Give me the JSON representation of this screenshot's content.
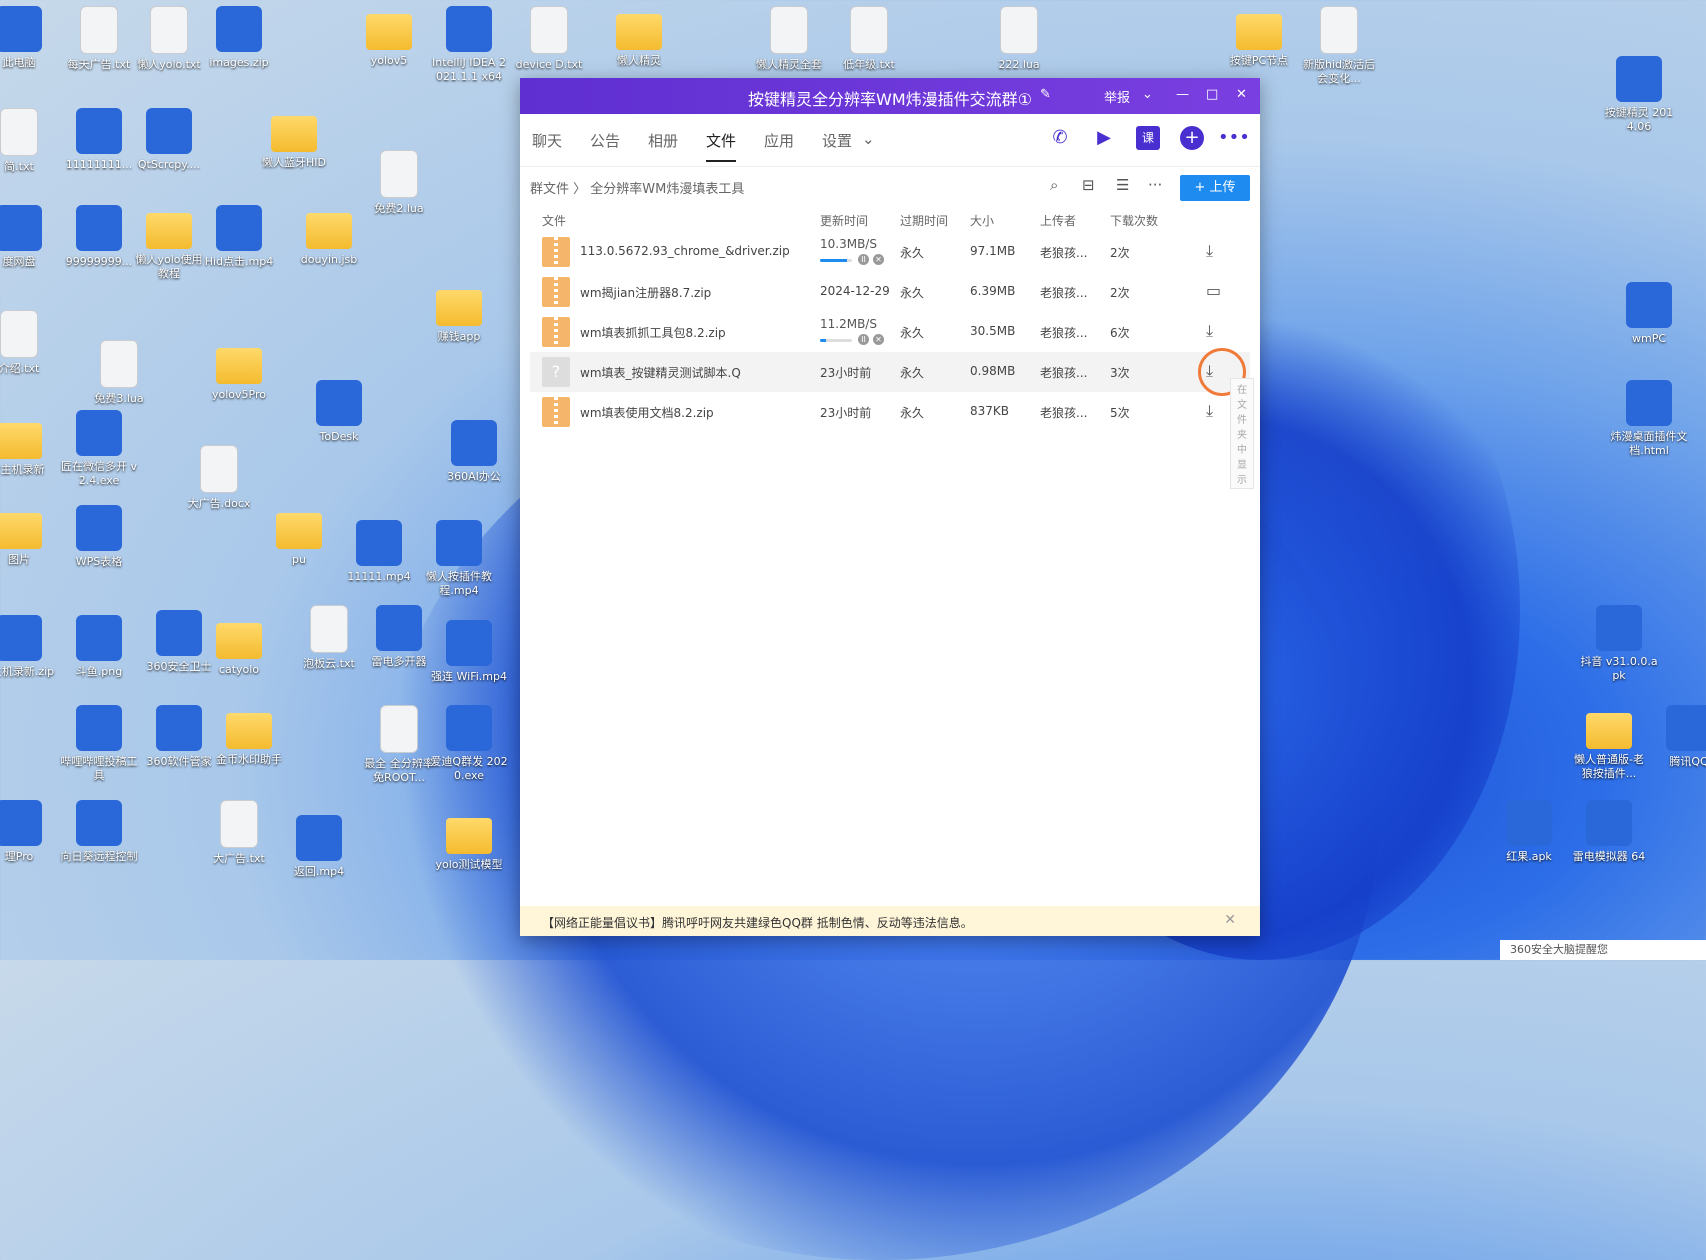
{
  "desktop": {
    "icons": [
      {
        "label": "此电脑",
        "kind": "app"
      },
      {
        "label": "每天广告.txt",
        "kind": "file"
      },
      {
        "label": "懒人yolo.txt",
        "kind": "file"
      },
      {
        "label": "images.zip",
        "kind": "app"
      },
      {
        "label": "yolov5",
        "kind": "folder"
      },
      {
        "label": "IntelliJ IDEA 2021.1.1 x64",
        "kind": "app"
      },
      {
        "label": "device D.txt",
        "kind": "file"
      },
      {
        "label": "懒人精灵",
        "kind": "folder"
      },
      {
        "label": "懒人精灵全套",
        "kind": "file"
      },
      {
        "label": "低年级.txt",
        "kind": "file"
      },
      {
        "label": "222.lua",
        "kind": "file"
      },
      {
        "label": "按键PC节点",
        "kind": "folder"
      },
      {
        "label": "新版hid激活后会变化...",
        "kind": "file"
      },
      {
        "label": "按键精灵 2014.06",
        "kind": "app"
      },
      {
        "label": "简.txt",
        "kind": "file"
      },
      {
        "label": "11111111...",
        "kind": "app"
      },
      {
        "label": "QtScrcpy....",
        "kind": "app"
      },
      {
        "label": "懒人蓝牙HID",
        "kind": "folder"
      },
      {
        "label": "免费2.lua",
        "kind": "file"
      },
      {
        "label": "度网盘",
        "kind": "app"
      },
      {
        "label": "99999999...",
        "kind": "app"
      },
      {
        "label": "懒人yolo使用教程",
        "kind": "folder"
      },
      {
        "label": "Hid点击.mp4",
        "kind": "app"
      },
      {
        "label": "douyin.jsb",
        "kind": "folder"
      },
      {
        "label": "赚钱app",
        "kind": "folder"
      },
      {
        "label": "wmPC",
        "kind": "app"
      },
      {
        "label": "介绍.txt",
        "kind": "file"
      },
      {
        "label": "免费3.lua",
        "kind": "file"
      },
      {
        "label": "yolov5Pro",
        "kind": "folder"
      },
      {
        "label": "ToDesk",
        "kind": "app"
      },
      {
        "label": "360AI办公",
        "kind": "app"
      },
      {
        "label": "炜漫桌面插件文档.html",
        "kind": "app"
      },
      {
        "label": "2主机录新",
        "kind": "folder"
      },
      {
        "label": "匠在微信多开 v2.4.exe",
        "kind": "app"
      },
      {
        "label": "大广告.docx",
        "kind": "file"
      },
      {
        "label": "图片",
        "kind": "folder"
      },
      {
        "label": "WPS表格",
        "kind": "app"
      },
      {
        "label": "pu",
        "kind": "folder"
      },
      {
        "label": "11111.mp4",
        "kind": "app"
      },
      {
        "label": "懒人按插件教程.mp4",
        "kind": "app"
      },
      {
        "label": "2主机录新.zip",
        "kind": "app"
      },
      {
        "label": "斗鱼.png",
        "kind": "app"
      },
      {
        "label": "360安全卫士",
        "kind": "app"
      },
      {
        "label": "catyolo",
        "kind": "folder"
      },
      {
        "label": "泡板云.txt",
        "kind": "file"
      },
      {
        "label": "雷电多开器",
        "kind": "app"
      },
      {
        "label": "强连 WiFi.mp4",
        "kind": "app"
      },
      {
        "label": "抖音 v31.0.0.apk",
        "kind": "app"
      },
      {
        "label": "哔哩哔哩投稿工具",
        "kind": "app"
      },
      {
        "label": "360软件管家",
        "kind": "app"
      },
      {
        "label": "金币水印助手",
        "kind": "folder"
      },
      {
        "label": "最全 全分辨率免ROOT...",
        "kind": "file"
      },
      {
        "label": "爱迪Q群发 2020.exe",
        "kind": "app"
      },
      {
        "label": "懒人普通版-老狼按插件...",
        "kind": "folder"
      },
      {
        "label": "腾讯QQ",
        "kind": "app"
      },
      {
        "label": "理Pro",
        "kind": "app"
      },
      {
        "label": "向日葵远程控制",
        "kind": "app"
      },
      {
        "label": "大广告.txt",
        "kind": "file"
      },
      {
        "label": "返回.mp4",
        "kind": "app"
      },
      {
        "label": "yolo测试模型",
        "kind": "folder"
      },
      {
        "label": "红果.apk",
        "kind": "app"
      },
      {
        "label": "雷电模拟器 64",
        "kind": "app"
      }
    ]
  },
  "window": {
    "title": "按键精灵全分辨率WM炜漫插件交流群①",
    "report_label": "举报",
    "tabs": [
      {
        "label": "聊天"
      },
      {
        "label": "公告"
      },
      {
        "label": "相册"
      },
      {
        "label": "文件"
      },
      {
        "label": "应用"
      },
      {
        "label": "设置"
      }
    ],
    "active_tab": "文件",
    "breadcrumb": {
      "root": "群文件",
      "current": "全分辨率WM炜漫填表工具"
    },
    "upload_label": "+ 上传",
    "columns": [
      "文件",
      "更新时间",
      "过期时间",
      "大小",
      "上传者",
      "下载次数"
    ],
    "files": [
      {
        "name": "113.0.5672.93_chrome_&driver.zip",
        "updated": "10.3MB/S",
        "expires": "永久",
        "size": "97.1MB",
        "uploader": "老狼孩...",
        "downloads": "2次",
        "progress": 0.85,
        "downloading": true,
        "action": "download-icon"
      },
      {
        "name": "wm揭jian注册器8.7.zip",
        "updated": "2024-12-29",
        "expires": "永久",
        "size": "6.39MB",
        "uploader": "老狼孩...",
        "downloads": "2次",
        "downloading": false,
        "action": "folder-icon"
      },
      {
        "name": "wm填表抓抓工具包8.2.zip",
        "updated": "11.2MB/S",
        "expires": "永久",
        "size": "30.5MB",
        "uploader": "老狼孩...",
        "downloads": "6次",
        "progress": 0.18,
        "downloading": true,
        "action": "download-icon"
      },
      {
        "name": "wm填表_按键精灵测试脚本.Q",
        "updated": "23小时前",
        "expires": "永久",
        "size": "0.98MB",
        "uploader": "老狼孩...",
        "downloads": "3次",
        "downloading": false,
        "action": "download-icon"
      },
      {
        "name": "wm填表使用文档8.2.zip",
        "updated": "23小时前",
        "expires": "永久",
        "size": "837KB",
        "uploader": "老狼孩...",
        "downloads": "5次",
        "downloading": false,
        "action": "download-icon"
      }
    ],
    "tooltip": "在文件夹中显示",
    "notice": "【网络正能量倡议书】腾讯呼吁网友共建绿色QQ群 抵制色情、反动等违法信息。"
  },
  "toast": "360安全大脑提醒您"
}
